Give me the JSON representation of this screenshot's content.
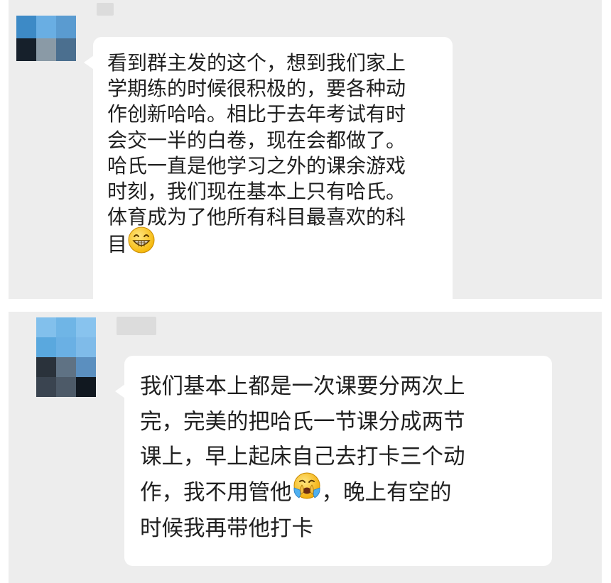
{
  "messages": [
    {
      "avatar_colors": [
        "#3d8ac6",
        "#69aee3",
        "#5a9bd0",
        "#16202b",
        "#8a9aa6",
        "#4b6f8f"
      ],
      "lines": [
        "看到群主发的这个，想到我们家上",
        "学期练的时候很积极的，要各种动",
        "作创新哈哈。相比于去年考试有时",
        "会交一半的白卷，现在会都做了。",
        "哈氏一直是他学习之外的课余游戏",
        "时刻，我们现在基本上只有哈氏。",
        "体育成为了他所有科目最喜欢的科",
        "目"
      ],
      "emoji": "grinning-face-emoji"
    },
    {
      "avatar_colors": [
        "#82c0ec",
        "#6fb5e6",
        "#88c3ee",
        "#5aa8de",
        "#6ab0e4",
        "#7fbbe9",
        "#2a323b",
        "#5f7284",
        "#5b8fbf",
        "#3a4450",
        "#4d5a68",
        "#111820"
      ],
      "lines": [
        "我们基本上都是一次课要分两次上",
        "完，完美的把哈氏一节课分成两节",
        "课上，早上起床自己去打卡三个动"
      ],
      "line4_before": "作，我不用管他",
      "line4_after": "，晚上有空的",
      "line5": "时候我再带他打卡",
      "emoji": "crying-laughing-face-emoji"
    }
  ]
}
